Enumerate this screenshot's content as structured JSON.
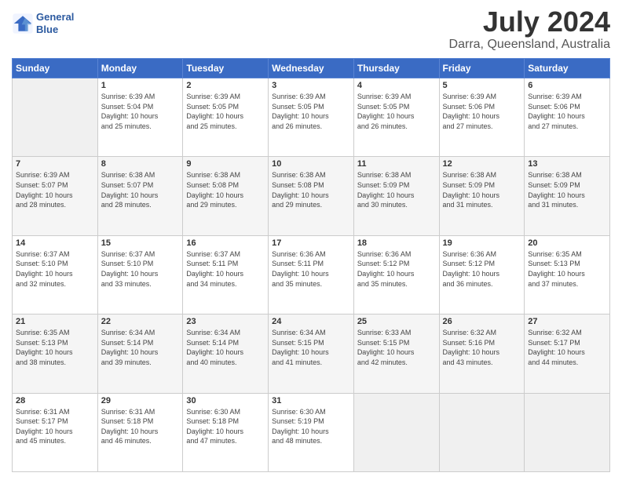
{
  "header": {
    "logo_line1": "General",
    "logo_line2": "Blue",
    "month": "July 2024",
    "location": "Darra, Queensland, Australia"
  },
  "days_of_week": [
    "Sunday",
    "Monday",
    "Tuesday",
    "Wednesday",
    "Thursday",
    "Friday",
    "Saturday"
  ],
  "weeks": [
    [
      {
        "day": "",
        "info": ""
      },
      {
        "day": "1",
        "info": "Sunrise: 6:39 AM\nSunset: 5:04 PM\nDaylight: 10 hours\nand 25 minutes."
      },
      {
        "day": "2",
        "info": "Sunrise: 6:39 AM\nSunset: 5:05 PM\nDaylight: 10 hours\nand 25 minutes."
      },
      {
        "day": "3",
        "info": "Sunrise: 6:39 AM\nSunset: 5:05 PM\nDaylight: 10 hours\nand 26 minutes."
      },
      {
        "day": "4",
        "info": "Sunrise: 6:39 AM\nSunset: 5:05 PM\nDaylight: 10 hours\nand 26 minutes."
      },
      {
        "day": "5",
        "info": "Sunrise: 6:39 AM\nSunset: 5:06 PM\nDaylight: 10 hours\nand 27 minutes."
      },
      {
        "day": "6",
        "info": "Sunrise: 6:39 AM\nSunset: 5:06 PM\nDaylight: 10 hours\nand 27 minutes."
      }
    ],
    [
      {
        "day": "7",
        "info": "Sunrise: 6:39 AM\nSunset: 5:07 PM\nDaylight: 10 hours\nand 28 minutes."
      },
      {
        "day": "8",
        "info": "Sunrise: 6:38 AM\nSunset: 5:07 PM\nDaylight: 10 hours\nand 28 minutes."
      },
      {
        "day": "9",
        "info": "Sunrise: 6:38 AM\nSunset: 5:08 PM\nDaylight: 10 hours\nand 29 minutes."
      },
      {
        "day": "10",
        "info": "Sunrise: 6:38 AM\nSunset: 5:08 PM\nDaylight: 10 hours\nand 29 minutes."
      },
      {
        "day": "11",
        "info": "Sunrise: 6:38 AM\nSunset: 5:09 PM\nDaylight: 10 hours\nand 30 minutes."
      },
      {
        "day": "12",
        "info": "Sunrise: 6:38 AM\nSunset: 5:09 PM\nDaylight: 10 hours\nand 31 minutes."
      },
      {
        "day": "13",
        "info": "Sunrise: 6:38 AM\nSunset: 5:09 PM\nDaylight: 10 hours\nand 31 minutes."
      }
    ],
    [
      {
        "day": "14",
        "info": "Sunrise: 6:37 AM\nSunset: 5:10 PM\nDaylight: 10 hours\nand 32 minutes."
      },
      {
        "day": "15",
        "info": "Sunrise: 6:37 AM\nSunset: 5:10 PM\nDaylight: 10 hours\nand 33 minutes."
      },
      {
        "day": "16",
        "info": "Sunrise: 6:37 AM\nSunset: 5:11 PM\nDaylight: 10 hours\nand 34 minutes."
      },
      {
        "day": "17",
        "info": "Sunrise: 6:36 AM\nSunset: 5:11 PM\nDaylight: 10 hours\nand 35 minutes."
      },
      {
        "day": "18",
        "info": "Sunrise: 6:36 AM\nSunset: 5:12 PM\nDaylight: 10 hours\nand 35 minutes."
      },
      {
        "day": "19",
        "info": "Sunrise: 6:36 AM\nSunset: 5:12 PM\nDaylight: 10 hours\nand 36 minutes."
      },
      {
        "day": "20",
        "info": "Sunrise: 6:35 AM\nSunset: 5:13 PM\nDaylight: 10 hours\nand 37 minutes."
      }
    ],
    [
      {
        "day": "21",
        "info": "Sunrise: 6:35 AM\nSunset: 5:13 PM\nDaylight: 10 hours\nand 38 minutes."
      },
      {
        "day": "22",
        "info": "Sunrise: 6:34 AM\nSunset: 5:14 PM\nDaylight: 10 hours\nand 39 minutes."
      },
      {
        "day": "23",
        "info": "Sunrise: 6:34 AM\nSunset: 5:14 PM\nDaylight: 10 hours\nand 40 minutes."
      },
      {
        "day": "24",
        "info": "Sunrise: 6:34 AM\nSunset: 5:15 PM\nDaylight: 10 hours\nand 41 minutes."
      },
      {
        "day": "25",
        "info": "Sunrise: 6:33 AM\nSunset: 5:15 PM\nDaylight: 10 hours\nand 42 minutes."
      },
      {
        "day": "26",
        "info": "Sunrise: 6:32 AM\nSunset: 5:16 PM\nDaylight: 10 hours\nand 43 minutes."
      },
      {
        "day": "27",
        "info": "Sunrise: 6:32 AM\nSunset: 5:17 PM\nDaylight: 10 hours\nand 44 minutes."
      }
    ],
    [
      {
        "day": "28",
        "info": "Sunrise: 6:31 AM\nSunset: 5:17 PM\nDaylight: 10 hours\nand 45 minutes."
      },
      {
        "day": "29",
        "info": "Sunrise: 6:31 AM\nSunset: 5:18 PM\nDaylight: 10 hours\nand 46 minutes."
      },
      {
        "day": "30",
        "info": "Sunrise: 6:30 AM\nSunset: 5:18 PM\nDaylight: 10 hours\nand 47 minutes."
      },
      {
        "day": "31",
        "info": "Sunrise: 6:30 AM\nSunset: 5:19 PM\nDaylight: 10 hours\nand 48 minutes."
      },
      {
        "day": "",
        "info": ""
      },
      {
        "day": "",
        "info": ""
      },
      {
        "day": "",
        "info": ""
      }
    ]
  ]
}
